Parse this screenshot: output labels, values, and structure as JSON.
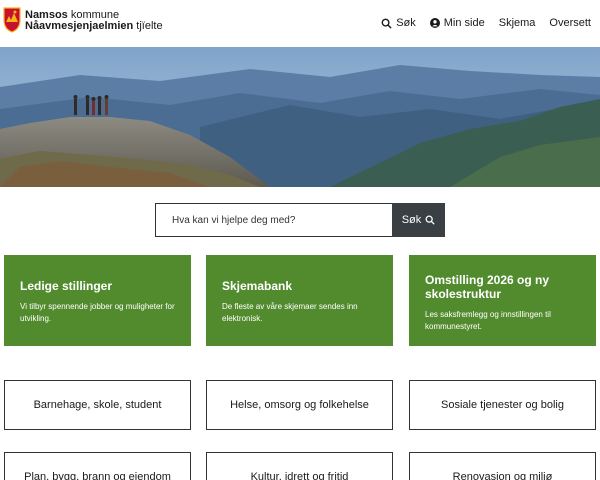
{
  "header": {
    "brand_line1_bold": "Namsos",
    "brand_line1_rest": " kommune",
    "brand_line2_bold": "Nåavmesjenjaelmien",
    "brand_line2_rest": " tjïelte",
    "nav": [
      {
        "label": "Søk",
        "icon": "search-icon"
      },
      {
        "label": "Min side",
        "icon": "user-circle-icon"
      },
      {
        "label": "Skjema"
      },
      {
        "label": "Oversett"
      }
    ]
  },
  "search": {
    "placeholder": "Hva kan vi hjelpe deg med?",
    "button_label": "Søk"
  },
  "cards": [
    {
      "title": "Ledige stillinger",
      "text": "Vi tilbyr spennende jobber og muligheter for utvikling."
    },
    {
      "title": "Skjemabank",
      "text": "De fleste av våre skjemaer sendes inn elektronisk."
    },
    {
      "title": "Omstilling 2026 og ny skolestruktur",
      "text": "Les saksfremlegg og innstillingen til kommunestyret."
    }
  ],
  "categories": [
    "Barnehage, skole, student",
    "Helse, omsorg og folkehelse",
    "Sosiale tjenester og bolig",
    "Plan, bygg, brann og eiendom",
    "Kultur, idrett og fritid",
    "Renovasjon og miljø"
  ],
  "colors": {
    "card_green": "#528b2e",
    "search_button": "#3a3f44",
    "logo_red": "#c8102e",
    "logo_gold": "#f2b51c"
  }
}
